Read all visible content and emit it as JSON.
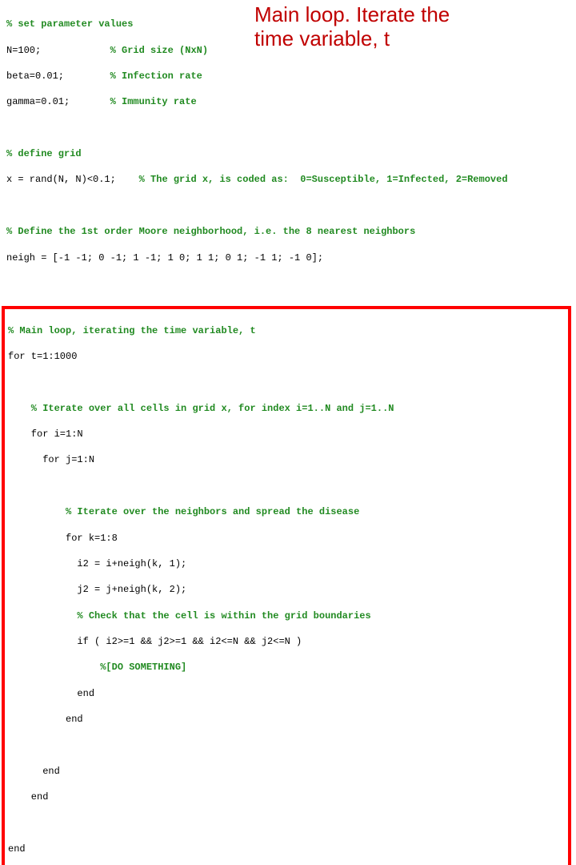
{
  "callout": {
    "line1": "Main loop. Iterate the",
    "line2": "time variable, t"
  },
  "top": {
    "c1": "% set parameter values",
    "l1a": "N=100;            ",
    "l1b": "% Grid size (NxN)",
    "l2a": "beta=0.01;        ",
    "l2b": "% Infection rate",
    "l3a": "gamma=0.01;       ",
    "l3b": "% Immunity rate",
    "blank1": " ",
    "c2": "% define grid",
    "l4a": "x = rand(N, N)<0.1;    ",
    "l4b": "% The grid x, is coded as:  0=Susceptible, 1=Infected, 2=Removed",
    "blank2": " ",
    "c3": "% Define the 1st order Moore neighborhood, i.e. the 8 nearest neighbors",
    "l5": "neigh = [-1 -1; 0 -1; 1 -1; 1 0; 1 1; 0 1; -1 1; -1 0];",
    "blank3": " "
  },
  "box": {
    "c1": "% Main loop, iterating the time variable, t",
    "l1": "for t=1:1000",
    "blank1": " ",
    "c2": "    % Iterate over all cells in grid x, for index i=1..N and j=1..N",
    "l2": "    for i=1:N",
    "l3": "      for j=1:N",
    "blank2": " ",
    "c3": "          % Iterate over the neighbors and spread the disease",
    "l4": "          for k=1:8",
    "l5": "            i2 = i+neigh(k, 1);",
    "l6": "            j2 = j+neigh(k, 2);",
    "c4": "            % Check that the cell is within the grid boundaries",
    "l7": "            if ( i2>=1 && j2>=1 && i2<=N && j2<=N )",
    "c5": "                %[DO SOMETHING]",
    "l8": "            end",
    "l9": "          end",
    "blank3": " ",
    "l10": "      end",
    "l11": "    end",
    "blank4": " ",
    "l12": "end"
  }
}
